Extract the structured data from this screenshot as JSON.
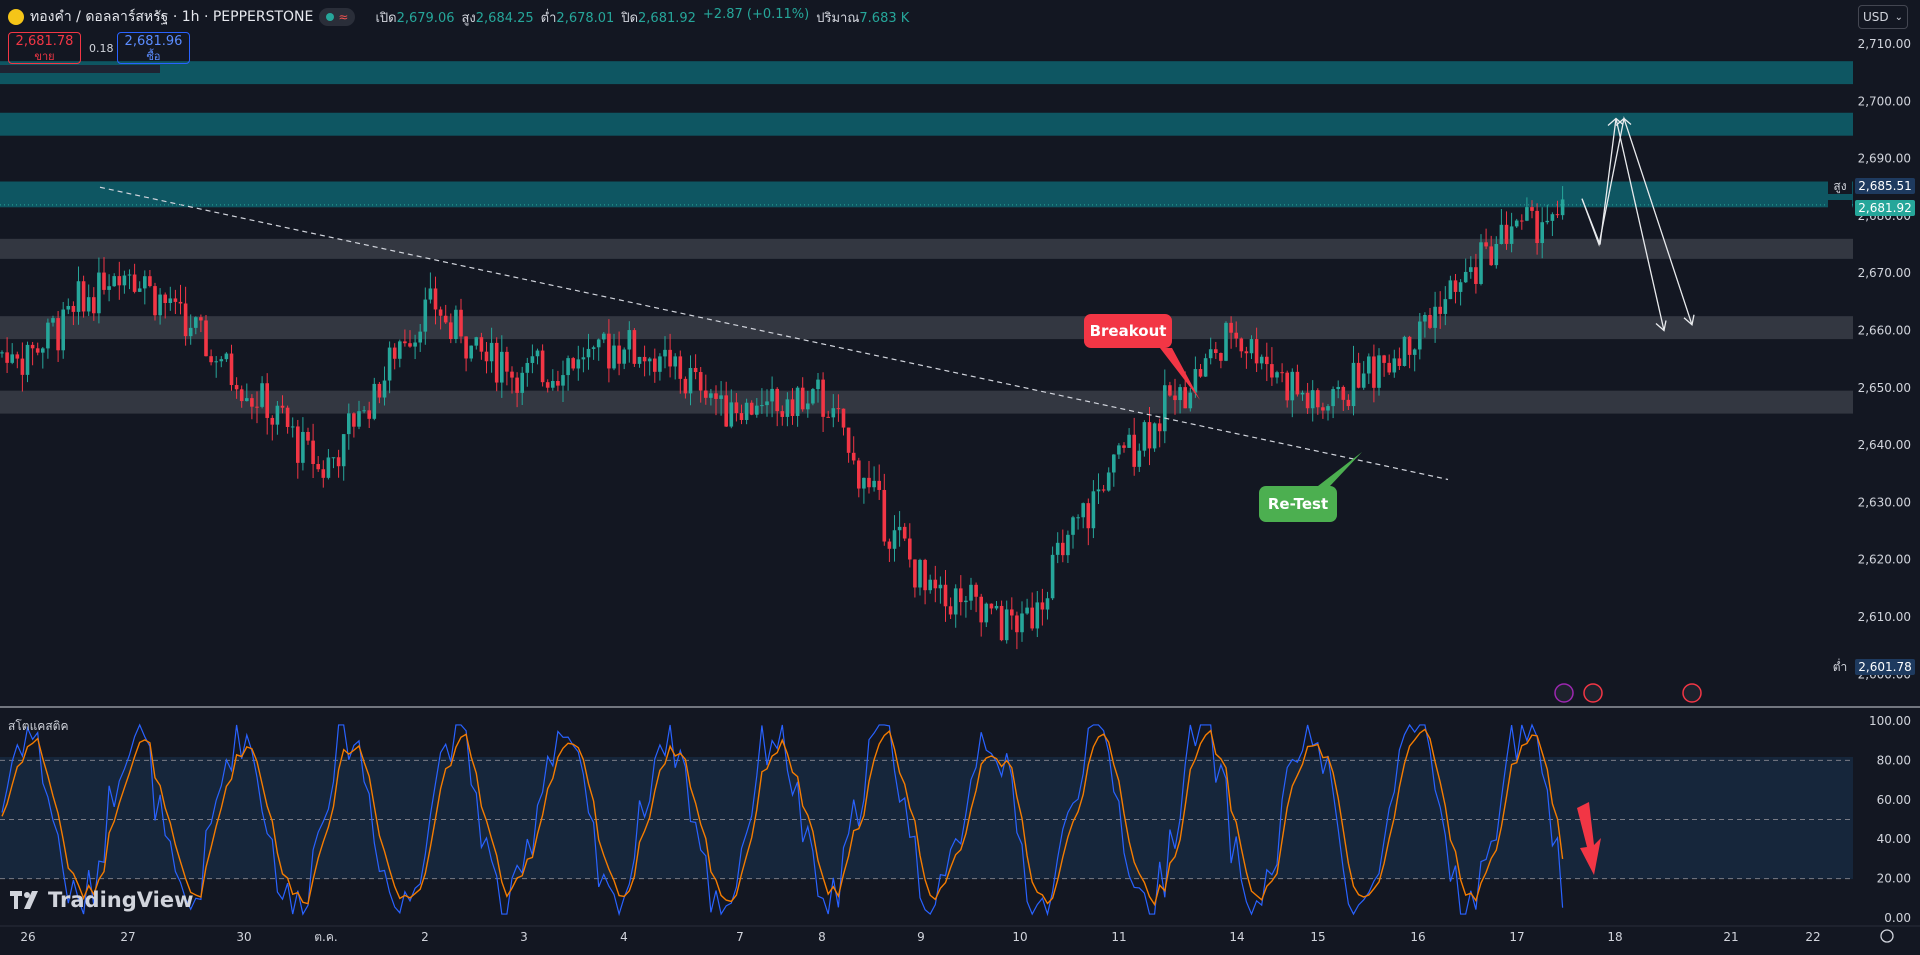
{
  "header": {
    "symbol_title": "ทองคำ / ดอลลาร์สหรัฐ · 1h · PEPPERSTONE",
    "status_icon": "wave-icon",
    "open_label": "เปิด",
    "open_value": "2,679.06",
    "high_label": "สูง",
    "high_value": "2,684.25",
    "low_label": "ต่ำ",
    "low_value": "2,678.01",
    "close_label": "ปิด",
    "close_value": "2,681.92",
    "change": "+2.87 (+0.11%)",
    "volume_label": "ปริมาณ",
    "volume_value": "7.683 K"
  },
  "trade": {
    "sell_price": "2,681.78",
    "sell_label": "ขาย",
    "spread": "0.18",
    "buy_price": "2,681.96",
    "buy_label": "ซื้อ"
  },
  "currency_select": "USD",
  "price_axis": {
    "ticks": [
      "2,710.00",
      "2,700.00",
      "2,690.00",
      "2,680.00",
      "2,670.00",
      "2,660.00",
      "2,650.00",
      "2,640.00",
      "2,630.00",
      "2,620.00",
      "2,610.00",
      "2,600.00"
    ],
    "high_label": "สูง",
    "high_value": "2,685.51",
    "last_value": "2,681.92",
    "low_label": "ต่ำ",
    "low_value": "2,601.78"
  },
  "time_axis": {
    "labels": [
      "26",
      "27",
      "30",
      "ต.ค.",
      "2",
      "3",
      "4",
      "7",
      "8",
      "9",
      "10",
      "11",
      "14",
      "15",
      "16",
      "17",
      "18",
      "21",
      "22"
    ]
  },
  "annotations": {
    "breakout": "Breakout",
    "retest": "Re-Test"
  },
  "indicator": {
    "name": "สโตแคสติค",
    "ticks": [
      "100.00",
      "80.00",
      "60.00",
      "40.00",
      "20.00",
      "0.00"
    ]
  },
  "branding": {
    "name": "TradingView"
  },
  "colors": {
    "background": "#131722",
    "up_candle": "#26a69a",
    "down_candle": "#f23645",
    "zone_teal": "#0e5a66",
    "zone_gray": "#3a3d47",
    "k_line": "#2962ff",
    "d_line": "#f57c00",
    "breakout": "#f23645",
    "retest": "#4caf50"
  },
  "chart_data": {
    "type": "candlestick",
    "symbol": "XAUUSD",
    "interval": "1h",
    "ylim": [
      2600,
      2713
    ],
    "key_prices": {
      "high": 2685.51,
      "last": 2681.92,
      "low": 2601.78
    },
    "resistance_zones": [
      [
        2703,
        2707
      ],
      [
        2694,
        2698
      ],
      [
        2681.5,
        2686
      ],
      [
        2672.5,
        2676
      ],
      [
        2658.5,
        2662.5
      ],
      [
        2645.5,
        2649.5
      ]
    ],
    "trend_line": {
      "start": [
        "27",
        2685
      ],
      "end": [
        "15",
        2634
      ]
    },
    "price_path": [
      [
        "26",
        2656
      ],
      [
        "27",
        2672
      ],
      [
        "30",
        2650
      ],
      [
        "ต.ค.",
        2636
      ],
      [
        "2",
        2664
      ],
      [
        "3",
        2652
      ],
      [
        "4",
        2658
      ],
      [
        "7",
        2646
      ],
      [
        "8",
        2648
      ],
      [
        "9",
        2616
      ],
      [
        "10",
        2608
      ],
      [
        "11",
        2638
      ],
      [
        "14",
        2660
      ],
      [
        "15",
        2646
      ],
      [
        "16",
        2660
      ],
      [
        "17",
        2679
      ]
    ],
    "projection_paths": [
      [
        2683,
        2675,
        2697,
        2660
      ],
      [
        2683,
        2675,
        2697,
        2661
      ]
    ],
    "stochastic": {
      "ylim": [
        0,
        100
      ],
      "bands": [
        20,
        50,
        80
      ]
    }
  }
}
